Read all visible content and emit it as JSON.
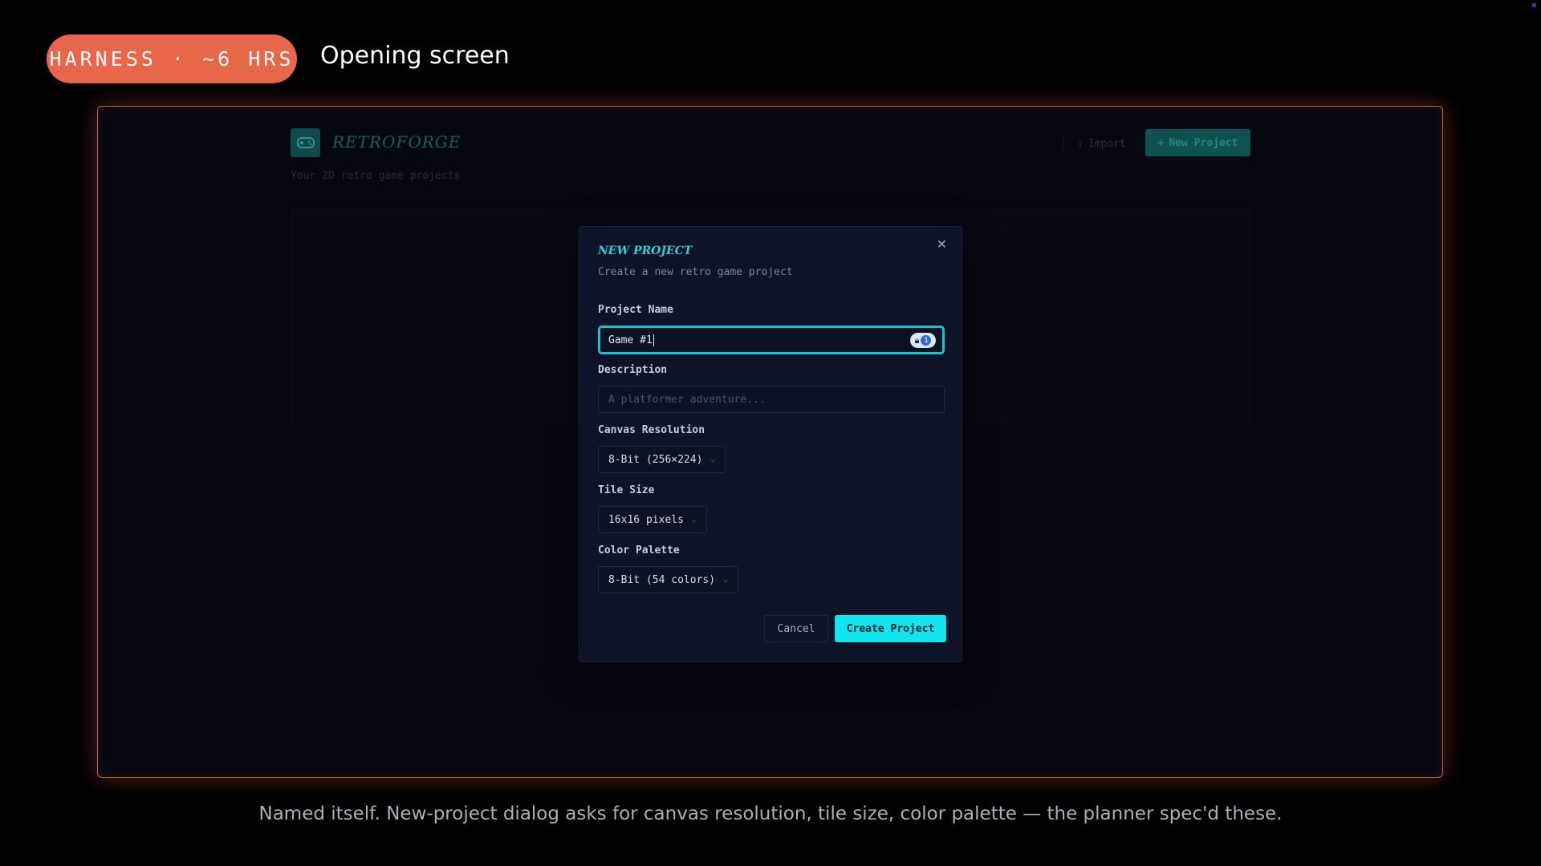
{
  "slide": {
    "badge": "HARNESS · ~6 HRS",
    "title": "Opening screen",
    "caption": "Named itself. New-project dialog asks for canvas resolution, tile size, color palette — the planner spec'd these."
  },
  "app": {
    "name": "RETROFORGE",
    "subtitle": "Your 2D retro game projects",
    "import_label": "Import",
    "new_project_label": "New Project",
    "logo_icon": "gamepad-icon"
  },
  "modal": {
    "title": "NEW PROJECT",
    "subtitle": "Create a new retro game project",
    "project_name": {
      "label": "Project Name",
      "value": "Game #1"
    },
    "description": {
      "label": "Description",
      "placeholder": "A platformer adventure..."
    },
    "canvas_resolution": {
      "label": "Canvas Resolution",
      "value": "8-Bit (256×224)"
    },
    "tile_size": {
      "label": "Tile Size",
      "value": "16x16 pixels"
    },
    "color_palette": {
      "label": "Color Palette",
      "value": "8-Bit (54 colors)"
    },
    "cancel_label": "Cancel",
    "create_label": "Create Project"
  },
  "colors": {
    "badge": "#e8674a",
    "accent": "#11e6f0",
    "frame_border": "#c85a3c"
  }
}
